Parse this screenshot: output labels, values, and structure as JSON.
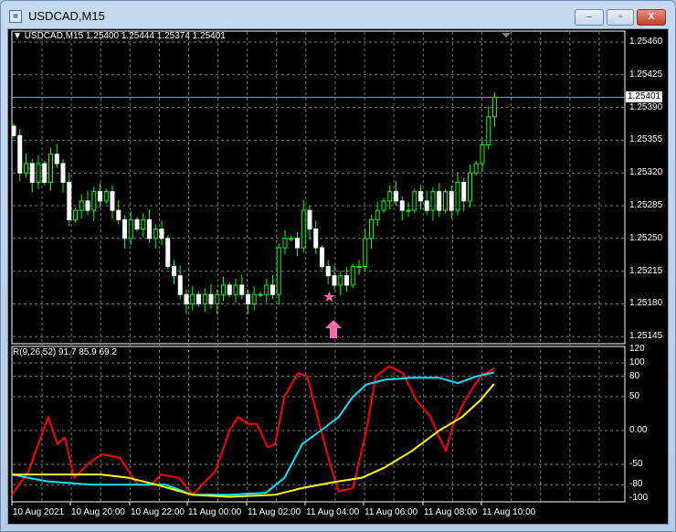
{
  "window": {
    "title": "USDCAD,M15",
    "minimize": "‒",
    "restore": "▫",
    "close": "X"
  },
  "chart_data": [
    {
      "type": "candlestick",
      "title": "USDCAD,M15  1.25400 1.25444 1.25374 1.25401",
      "symbol": "USDCAD",
      "timeframe": "M15",
      "current_price": "1.25401",
      "ylim": [
        1.25145,
        1.2546
      ],
      "y_ticks": [
        "1.25460",
        "1.25425",
        "1.25390",
        "1.25355",
        "1.25320",
        "1.25285",
        "1.25250",
        "1.25215",
        "1.25180",
        "1.25145"
      ],
      "closes": [
        1.2536,
        1.2532,
        1.2533,
        1.2531,
        1.2533,
        1.2531,
        1.2534,
        1.2533,
        1.2531,
        1.2527,
        1.2528,
        1.2529,
        1.2528,
        1.253,
        1.2529,
        1.253,
        1.2528,
        1.2527,
        1.2525,
        1.2527,
        1.2526,
        1.2527,
        1.2525,
        1.2526,
        1.2525,
        1.2522,
        1.2521,
        1.2519,
        1.2518,
        1.2519,
        1.2518,
        1.2519,
        1.2518,
        1.2519,
        1.252,
        1.2519,
        1.252,
        1.2519,
        1.2518,
        1.2519,
        1.2519,
        1.252,
        1.2519,
        1.2524,
        1.2525,
        1.2525,
        1.2524,
        1.2528,
        1.2526,
        1.2524,
        1.2522,
        1.2521,
        1.252,
        1.2521,
        1.252,
        1.2522,
        1.2522,
        1.2525,
        1.2527,
        1.2528,
        1.2529,
        1.253,
        1.2529,
        1.2528,
        1.2528,
        1.253,
        1.2529,
        1.2528,
        1.253,
        1.2528,
        1.253,
        1.2528,
        1.2531,
        1.2529,
        1.2532,
        1.2533,
        1.2535,
        1.2538,
        1.25401
      ],
      "markers": [
        {
          "type": "star",
          "bar": 51,
          "price": 1.2519,
          "color": "#ff69b4"
        },
        {
          "type": "arrow-up",
          "bar": 52
        }
      ],
      "x_ticks": [
        "10 Aug 2021",
        "10 Aug 20:00",
        "10 Aug 22:00",
        "11 Aug 00:00",
        "11 Aug 02:00",
        "11 Aug 04:00",
        "11 Aug 06:00",
        "11 Aug 08:00",
        "11 Aug 10:00"
      ]
    },
    {
      "type": "line",
      "title": "R(9,26,52) 91.7 85.9 69.2",
      "ylim": [
        -100,
        120
      ],
      "y_ticks": [
        "120",
        "100",
        "80",
        "50",
        "0.00",
        "-50",
        "-80",
        "-100"
      ],
      "series": [
        {
          "name": "R9",
          "color": "#ff0000",
          "points": [
            [
              -0.3,
              -95
            ],
            [
              2.4,
              -60
            ],
            [
              5.6,
              20
            ],
            [
              7.1,
              -20
            ],
            [
              8.3,
              -10
            ],
            [
              9.8,
              -70
            ],
            [
              12,
              -50
            ],
            [
              14.2,
              -35
            ],
            [
              17.2,
              -40
            ],
            [
              20.1,
              -80
            ],
            [
              22.4,
              -80
            ],
            [
              23.9,
              -65
            ],
            [
              26.8,
              -70
            ],
            [
              29,
              -95
            ],
            [
              32.7,
              -60
            ],
            [
              35,
              0
            ],
            [
              36.4,
              20
            ],
            [
              37.9,
              10
            ],
            [
              39.4,
              10
            ],
            [
              41.2,
              -25
            ],
            [
              42.4,
              -20
            ],
            [
              43.9,
              50
            ],
            [
              46.1,
              85
            ],
            [
              47.6,
              80
            ],
            [
              49,
              30
            ],
            [
              51.3,
              -50
            ],
            [
              52.7,
              -90
            ],
            [
              55,
              -85
            ],
            [
              57.2,
              0
            ],
            [
              58.7,
              80
            ],
            [
              60.9,
              95
            ],
            [
              63.1,
              85
            ],
            [
              65.3,
              45
            ],
            [
              67.6,
              20
            ],
            [
              69,
              -10
            ],
            [
              70.1,
              -30
            ],
            [
              71.3,
              10
            ],
            [
              73.5,
              50
            ],
            [
              75.7,
              80
            ],
            [
              77.9,
              92
            ]
          ]
        },
        {
          "name": "R26",
          "color": "#00e5ff",
          "points": [
            [
              -0.3,
              -65
            ],
            [
              5.3,
              -75
            ],
            [
              12.7,
              -80
            ],
            [
              20.1,
              -80
            ],
            [
              24.6,
              -80
            ],
            [
              29,
              -95
            ],
            [
              35,
              -95
            ],
            [
              40.9,
              -92
            ],
            [
              43.9,
              -70
            ],
            [
              46.8,
              -20
            ],
            [
              49.8,
              0
            ],
            [
              52.7,
              20
            ],
            [
              55,
              50
            ],
            [
              57.2,
              68
            ],
            [
              60.1,
              75
            ],
            [
              64.6,
              78
            ],
            [
              69,
              78
            ],
            [
              72,
              70
            ],
            [
              75,
              80
            ],
            [
              77.9,
              86
            ]
          ]
        },
        {
          "name": "R52",
          "color": "#ffff00",
          "points": [
            [
              -0.3,
              -65
            ],
            [
              8.3,
              -65
            ],
            [
              14.2,
              -65
            ],
            [
              18.7,
              -70
            ],
            [
              23.1,
              -80
            ],
            [
              29,
              -95
            ],
            [
              35,
              -98
            ],
            [
              42.4,
              -95
            ],
            [
              46.8,
              -85
            ],
            [
              52.7,
              -75
            ],
            [
              56.4,
              -70
            ],
            [
              60.1,
              -55
            ],
            [
              64.6,
              -30
            ],
            [
              69,
              0
            ],
            [
              72.7,
              20
            ],
            [
              75.7,
              45
            ],
            [
              77.9,
              69
            ]
          ]
        }
      ]
    }
  ]
}
